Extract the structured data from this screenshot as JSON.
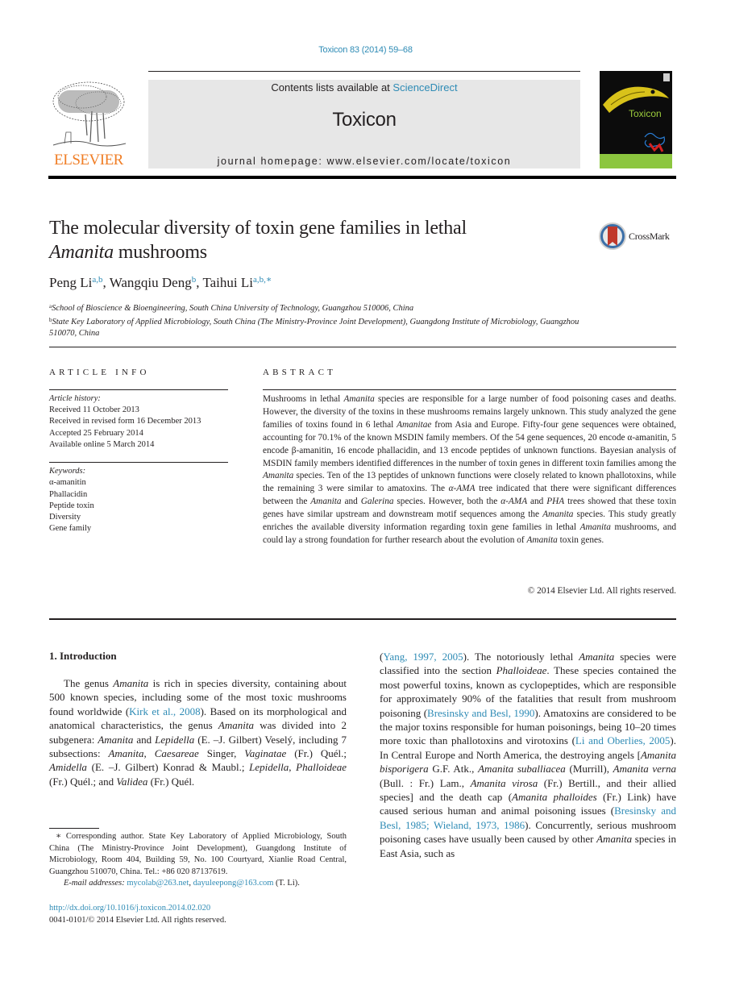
{
  "journal_ref": "Toxicon 83 (2014) 59–68",
  "header": {
    "publisher_wordmark": "ELSEVIER",
    "contents_prefix": "Contents lists available at ",
    "contents_link": "ScienceDirect",
    "journal_name": "Toxicon",
    "homepage": "journal homepage: www.elsevier.com/locate/toxicon",
    "cover_title": "Toxicon"
  },
  "article": {
    "title_line1": "The molecular diversity of toxin gene families in lethal",
    "title_line2_italic": "Amanita",
    "title_line2_rest": " mushrooms",
    "crossmark_label": "CrossMark",
    "authors": [
      {
        "name": "Peng Li",
        "sup": "a,b",
        "sep": ", "
      },
      {
        "name": "Wangqiu Deng",
        "sup": "b",
        "sep": ", "
      },
      {
        "name": "Taihui Li",
        "sup": "a,b,∗",
        "sep": ""
      }
    ],
    "affiliations": [
      {
        "sup": "a",
        "text": "School of Bioscience & Bioengineering, South China University of Technology, Guangzhou 510006, China"
      },
      {
        "sup": "b",
        "text": "State Key Laboratory of Applied Microbiology, South China (The Ministry-Province Joint Development), Guangdong Institute of Microbiology, Guangzhou 510070, China"
      }
    ]
  },
  "article_info": {
    "heading": "ARTICLE INFO",
    "history_label": "Article history:",
    "history": [
      "Received 11 October 2013",
      "Received in revised form 16 December 2013",
      "Accepted 25 February 2014",
      "Available online 5 March 2014"
    ],
    "keywords_label": "Keywords:",
    "keywords": [
      "α-amanitin",
      "Phallacidin",
      "Peptide toxin",
      "Diversity",
      "Gene family"
    ]
  },
  "abstract": {
    "heading": "ABSTRACT",
    "segments": [
      {
        "t": "Mushrooms in lethal "
      },
      {
        "t": "Amanita",
        "i": true
      },
      {
        "t": " species are responsible for a large number of food poisoning cases and deaths. However, the diversity of the toxins in these mushrooms remains largely unknown. This study analyzed the gene families of toxins found in 6 lethal "
      },
      {
        "t": "Amanitae",
        "i": true
      },
      {
        "t": " from Asia and Europe. Fifty-four gene sequences were obtained, accounting for 70.1% of the known MSDIN family members. Of the 54 gene sequences, 20 encode α-amanitin, 5 encode β-amanitin, 16 encode phallacidin, and 13 encode peptides of unknown functions. Bayesian analysis of MSDIN family members identified differences in the number of toxin genes in different toxin families among the "
      },
      {
        "t": "Amanita",
        "i": true
      },
      {
        "t": " species. Ten of the 13 peptides of unknown functions were closely related to known phallotoxins, while the remaining 3 were similar to amatoxins. The "
      },
      {
        "t": "α-AMA",
        "i": true
      },
      {
        "t": " tree indicated that there were significant differences between the "
      },
      {
        "t": "Amanita",
        "i": true
      },
      {
        "t": " and "
      },
      {
        "t": "Galerina",
        "i": true
      },
      {
        "t": " species. However, both the "
      },
      {
        "t": "α-AMA",
        "i": true
      },
      {
        "t": " and "
      },
      {
        "t": "PHA",
        "i": true
      },
      {
        "t": " trees showed that these toxin genes have similar upstream and downstream motif sequences among the "
      },
      {
        "t": "Amanita",
        "i": true
      },
      {
        "t": " species. This study greatly enriches the available diversity information regarding toxin gene families in lethal "
      },
      {
        "t": "Amanita",
        "i": true
      },
      {
        "t": " mushrooms, and could lay a strong foundation for further research about the evolution of "
      },
      {
        "t": "Amanita",
        "i": true
      },
      {
        "t": " toxin genes."
      }
    ],
    "copyright": "© 2014 Elsevier Ltd. All rights reserved."
  },
  "introduction": {
    "heading": "1.  Introduction",
    "left_segments": [
      {
        "t": "The genus "
      },
      {
        "t": "Amanita",
        "i": true
      },
      {
        "t": " is rich in species diversity, containing about 500 known species, including some of the most toxic mushrooms found worldwide ("
      },
      {
        "t": "Kirk et al., 2008",
        "l": true
      },
      {
        "t": "). Based on its morphological and anatomical characteristics, the genus "
      },
      {
        "t": "Amanita",
        "i": true
      },
      {
        "t": " was divided into 2 subgenera: "
      },
      {
        "t": "Amanita",
        "i": true
      },
      {
        "t": " and "
      },
      {
        "t": "Lepidella",
        "i": true
      },
      {
        "t": " (E. –J. Gilbert) Veselý, including 7 subsections: "
      },
      {
        "t": "Amanita",
        "i": true
      },
      {
        "t": ", "
      },
      {
        "t": "Caesareae",
        "i": true
      },
      {
        "t": " Singer, "
      },
      {
        "t": "Vaginatae",
        "i": true
      },
      {
        "t": " (Fr.) Quél.; "
      },
      {
        "t": "Amidella",
        "i": true
      },
      {
        "t": " (E. –J. Gilbert) Konrad & Maubl.; "
      },
      {
        "t": "Lepidella",
        "i": true
      },
      {
        "t": ", "
      },
      {
        "t": "Phalloideae",
        "i": true
      },
      {
        "t": " (Fr.) Quél.; and "
      },
      {
        "t": "Validea",
        "i": true
      },
      {
        "t": " (Fr.) Quél."
      }
    ],
    "right_segments": [
      {
        "t": "("
      },
      {
        "t": "Yang, 1997, 2005",
        "l": true
      },
      {
        "t": "). The notoriously lethal "
      },
      {
        "t": "Amanita",
        "i": true
      },
      {
        "t": " species were classified into the section "
      },
      {
        "t": "Phalloideae",
        "i": true
      },
      {
        "t": ". These species contained the most powerful toxins, known as cyclopeptides, which are responsible for approximately 90% of the fatalities that result from mushroom poisoning ("
      },
      {
        "t": "Bresinsky and Besl, 1990",
        "l": true
      },
      {
        "t": "). Amatoxins are considered to be the major toxins responsible for human poisonings, being 10–20 times more toxic than phallotoxins and virotoxins ("
      },
      {
        "t": "Li and Oberlies, 2005",
        "l": true
      },
      {
        "t": "). In Central Europe and North America, the destroying angels ["
      },
      {
        "t": "Amanita bisporigera",
        "i": true
      },
      {
        "t": " G.F. Atk., "
      },
      {
        "t": "Amanita suballiacea",
        "i": true
      },
      {
        "t": " (Murrill), "
      },
      {
        "t": "Amanita verna",
        "i": true
      },
      {
        "t": " (Bull. : Fr.) Lam., "
      },
      {
        "t": "Amanita virosa",
        "i": true
      },
      {
        "t": " (Fr.) Bertill., and their allied species] and the death cap ("
      },
      {
        "t": "Amanita phalloides",
        "i": true
      },
      {
        "t": " (Fr.) Link) have caused serious human and animal poisoning issues ("
      },
      {
        "t": "Bresinsky and Besl, 1985; Wieland, 1973, 1986",
        "l": true
      },
      {
        "t": "). Concurrently, serious mushroom poisoning cases have usually been caused by other "
      },
      {
        "t": "Amanita",
        "i": true
      },
      {
        "t": " species in East Asia, such as"
      }
    ]
  },
  "footnote": {
    "text": "∗ Corresponding author. State Key Laboratory of Applied Microbiology, South China (The Ministry-Province Joint Development), Guangdong Institute of Microbiology, Room 404, Building 59, No. 100 Courtyard, Xianlie Road Central, Guangzhou 510070, China. Tel.: +86 020 87137619.",
    "email_label": "E-mail addresses:",
    "email1": "mycolab@263.net",
    "email_sep": ", ",
    "email2": "dayuleepong@163.com",
    "email_suffix": " (T. Li)."
  },
  "doi": {
    "link": "http://dx.doi.org/10.1016/j.toxicon.2014.02.020",
    "issn_line": "0041-0101/© 2014 Elsevier Ltd. All rights reserved."
  }
}
